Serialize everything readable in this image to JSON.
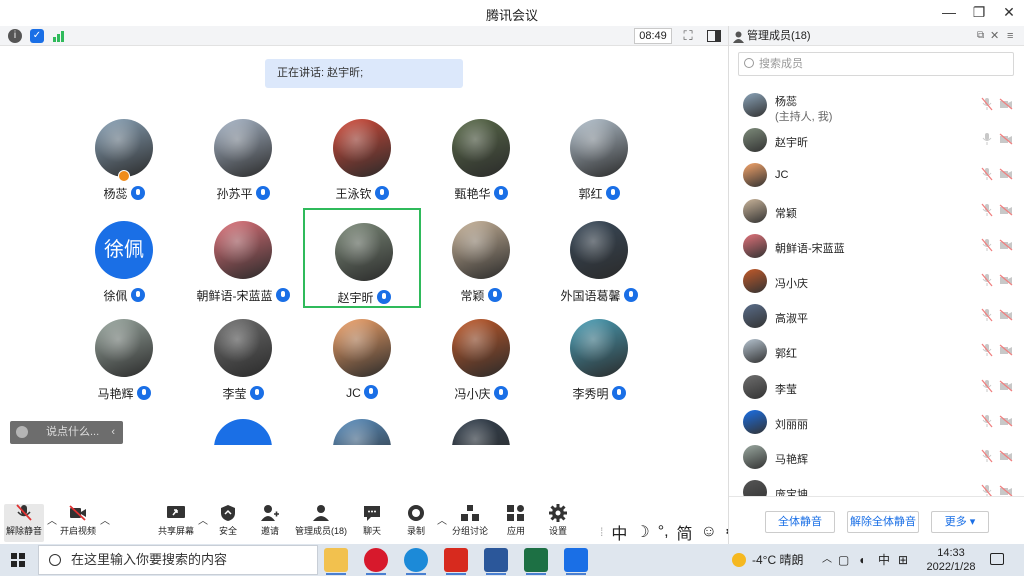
{
  "window": {
    "title": "腾讯会议",
    "minimize": "—",
    "restore": "❐",
    "close": "✕"
  },
  "status": {
    "time": "08:49"
  },
  "speaking": "正在讲话: 赵宇昕;",
  "participants": [
    {
      "name": "杨蕊",
      "avatar": "photo",
      "color": "#8aa3b8",
      "host": true
    },
    {
      "name": "孙苏平",
      "avatar": "photo",
      "color": "#a9b7c9"
    },
    {
      "name": "王泳钦",
      "avatar": "photo",
      "color": "#d44b3a"
    },
    {
      "name": "甄艳华",
      "avatar": "photo",
      "color": "#5a6b4a"
    },
    {
      "name": "郭红",
      "avatar": "photo",
      "color": "#b5c3cf"
    },
    {
      "name": "徐佩",
      "avatar": "text",
      "text": "徐佩",
      "color": "#1a6fe6"
    },
    {
      "name": "朝鲜语-宋蓝蓝",
      "avatar": "photo",
      "color": "#e0727a"
    },
    {
      "name": "赵宇昕",
      "avatar": "photo",
      "color": "#7d8b7a",
      "active": true
    },
    {
      "name": "常颖",
      "avatar": "photo",
      "color": "#c9b49a"
    },
    {
      "name": "外国语葛馨",
      "avatar": "photo",
      "color": "#3a4a5a"
    },
    {
      "name": "马艳辉",
      "avatar": "photo",
      "color": "#9aa8a0"
    },
    {
      "name": "李莹",
      "avatar": "photo",
      "color": "#6e6e6e"
    },
    {
      "name": "JC",
      "avatar": "photo",
      "color": "#f4a46a"
    },
    {
      "name": "冯小庆",
      "avatar": "photo",
      "color": "#c25a2a"
    },
    {
      "name": "李秀明",
      "avatar": "photo",
      "color": "#4aa0b8"
    },
    {
      "name": "",
      "avatar": "text",
      "text": "",
      "color": "#1a6fe6"
    },
    {
      "name": "",
      "avatar": "photo",
      "color": "#5a8fc0"
    },
    {
      "name": "",
      "avatar": "photo",
      "color": "#33404e"
    }
  ],
  "chat": {
    "placeholder": "说点什么...",
    "collapse": "‹"
  },
  "toolbar": {
    "unmute": "解除静音",
    "video": "开启视频",
    "share": "共享屏幕",
    "security": "安全",
    "invite": "邀请",
    "members": "管理成员(18)",
    "chat": "聊天",
    "record": "录制",
    "breakout": "分组讨论",
    "apps": "应用",
    "settings": "设置"
  },
  "ime": {
    "mode": "中",
    "moon": "☽",
    "punct": "°,",
    "simp": "简",
    "emoji": "☺",
    "gear": "⚙"
  },
  "panel": {
    "title": "管理成员(18)",
    "search_placeholder": "搜索成员",
    "members": [
      {
        "name": "杨蕊",
        "sub": "(主持人, 我)",
        "color": "#8aa3b8"
      },
      {
        "name": "赵宇昕",
        "color": "#7d8b7a",
        "mic_on": true
      },
      {
        "name": "JC",
        "color": "#f4a46a"
      },
      {
        "name": "常颖",
        "color": "#c9b49a"
      },
      {
        "name": "朝鲜语-宋蓝蓝",
        "color": "#e0727a"
      },
      {
        "name": "冯小庆",
        "color": "#c25a2a"
      },
      {
        "name": "高淑平",
        "color": "#5a6d8a"
      },
      {
        "name": "郭红",
        "color": "#b5c3cf"
      },
      {
        "name": "李莹",
        "color": "#6e6e6e"
      },
      {
        "name": "刘丽丽",
        "color": "#1a6fe6"
      },
      {
        "name": "马艳辉",
        "color": "#9aa8a0"
      },
      {
        "name": "庞宝坤",
        "color": "#555555"
      }
    ],
    "mute_all": "全体静音",
    "unmute_all": "解除全体静音",
    "more": "更多 ▾"
  },
  "taskbar": {
    "search_placeholder": "在这里输入你要搜索的内容",
    "weather": "-4°C 晴朗",
    "lang": "中",
    "time": "14:33",
    "date": "2022/1/28",
    "apps": [
      {
        "name": "file-explorer",
        "color": "#f2c14e"
      },
      {
        "name": "opera",
        "color": "#d7192c"
      },
      {
        "name": "edge",
        "color": "#1c8ad8"
      },
      {
        "name": "acrobat",
        "color": "#d72a1e"
      },
      {
        "name": "word",
        "color": "#2b579a"
      },
      {
        "name": "excel",
        "color": "#1d7044"
      },
      {
        "name": "tencent-meeting",
        "color": "#1a6fe6"
      }
    ]
  }
}
